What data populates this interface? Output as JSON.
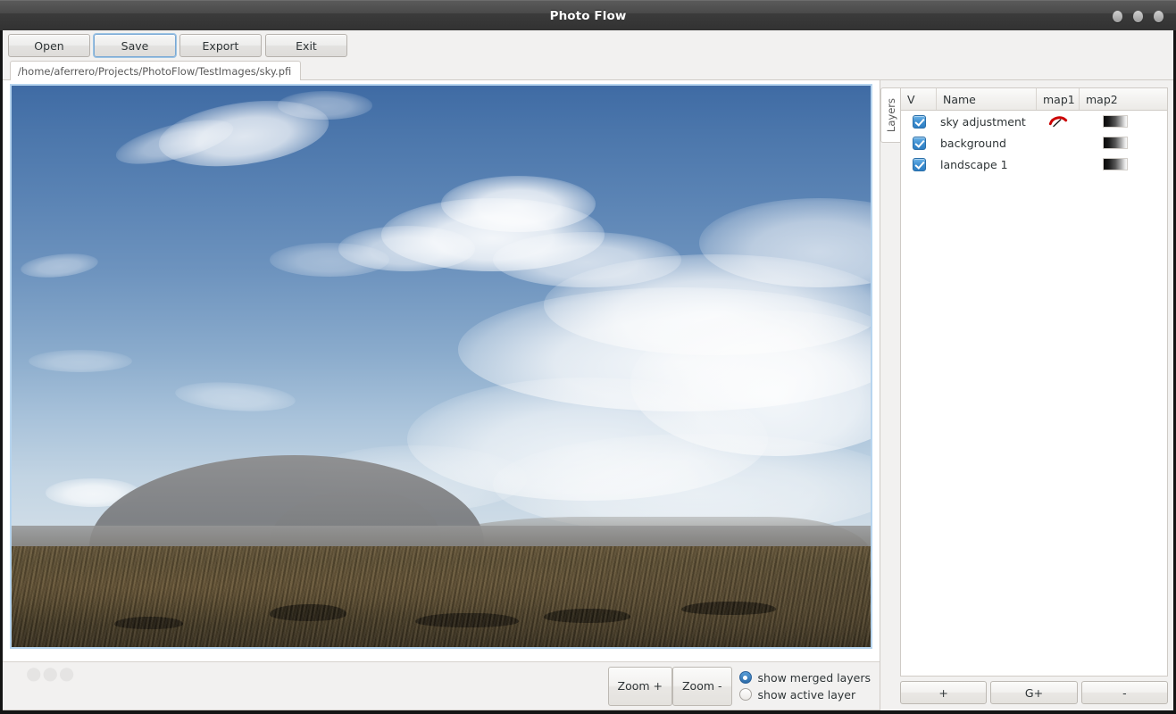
{
  "window": {
    "title": "Photo Flow",
    "controls": [
      "minimize-dot",
      "maximize-dot",
      "close-dot"
    ]
  },
  "toolbar": {
    "buttons": [
      {
        "label": "Open",
        "name": "open-button",
        "focused": false
      },
      {
        "label": "Save",
        "name": "save-button",
        "focused": true
      },
      {
        "label": "Export",
        "name": "export-button",
        "focused": false
      },
      {
        "label": "Exit",
        "name": "exit-button",
        "focused": false
      }
    ]
  },
  "document_tab": {
    "label": "/home/aferrero/Projects/PhotoFlow/TestImages/sky.pfi",
    "active": true
  },
  "canvas": {
    "image_description": "Landscape photograph: blue sky with cumulus clouds over a volcanic mountain and dry brown scrubland",
    "border_color": "#b7d5ef"
  },
  "canvas_bottom": {
    "zoom_in_label": "Zoom +",
    "zoom_out_label": "Zoom -",
    "view_mode_options": [
      {
        "label": "show merged layers",
        "selected": true
      },
      {
        "label": "show active layer",
        "selected": false
      }
    ]
  },
  "layers_panel": {
    "tab_label": "Layers",
    "columns": [
      "V",
      "Name",
      "map1",
      "map2"
    ],
    "rows": [
      {
        "visible": true,
        "name": "sky adjustment",
        "map1_icon": "red-curve-icon",
        "map2_thumb": "gradient-thumb"
      },
      {
        "visible": true,
        "name": "background",
        "map1_icon": "",
        "map2_thumb": "gradient-thumb"
      },
      {
        "visible": true,
        "name": "landscape 1",
        "map1_icon": "",
        "map2_thumb": "gradient-thumb"
      }
    ],
    "operations": [
      {
        "label": "+",
        "name": "add-layer-button"
      },
      {
        "label": "G+",
        "name": "add-group-button"
      },
      {
        "label": "-",
        "name": "remove-layer-button"
      }
    ]
  },
  "colors": {
    "accent": "#3d8ed0",
    "titlebar": "#3b3b3b",
    "chrome": "#f2f1f0",
    "curve_icon": "#cc0000",
    "canvas_border": "#b7d5ef"
  }
}
